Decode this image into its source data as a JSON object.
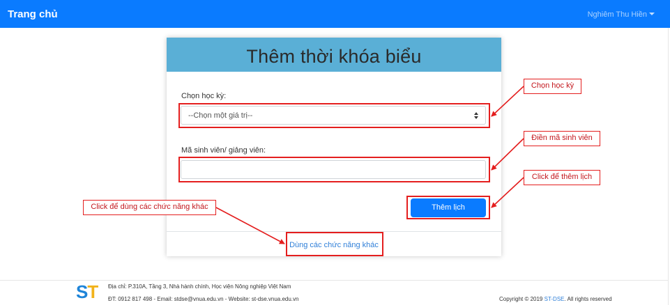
{
  "navbar": {
    "brand": "Trang chủ",
    "user_name": "Nghiêm Thu Hiền"
  },
  "card": {
    "title": "Thêm thời khóa biểu",
    "semester_label": "Chọn học kỳ:",
    "semester_value": "--Chọn một giá trị--",
    "student_id_label": "Mã sinh viên/ giảng viên:",
    "student_id_value": "",
    "submit_label": "Thêm lịch",
    "other_functions_link": "Dùng các chức năng khác"
  },
  "annotations": {
    "semester_note": "Chọn học kỳ",
    "student_id_note": "Điền mã sinh viên",
    "submit_note": "Click để thêm lịch",
    "link_note": "Click để dùng các chức năng khác",
    "color": "#e41e1e"
  },
  "footer": {
    "logo_s": "S",
    "logo_t": "T",
    "address": "Địa chỉ: P.310A, Tầng 3, Nhà hành chính, Học viện Nông nghiệp Việt Nam",
    "contact": "ĐT: 0912 817 498 - Email: stdse@vnua.edu.vn - Website: st-dse.vnua.edu.vn",
    "copyright_prefix": "Copyright © 2019",
    "copyright_link": "ST-DSE",
    "copyright_suffix": ". All rights reserved"
  },
  "colors": {
    "navbar": "#0a7bff",
    "card_header": "#5aafd6",
    "button": "#0a7bff",
    "link": "#2f7fd8",
    "logo_s": "#1e84d8",
    "logo_t": "#f2b31b"
  }
}
